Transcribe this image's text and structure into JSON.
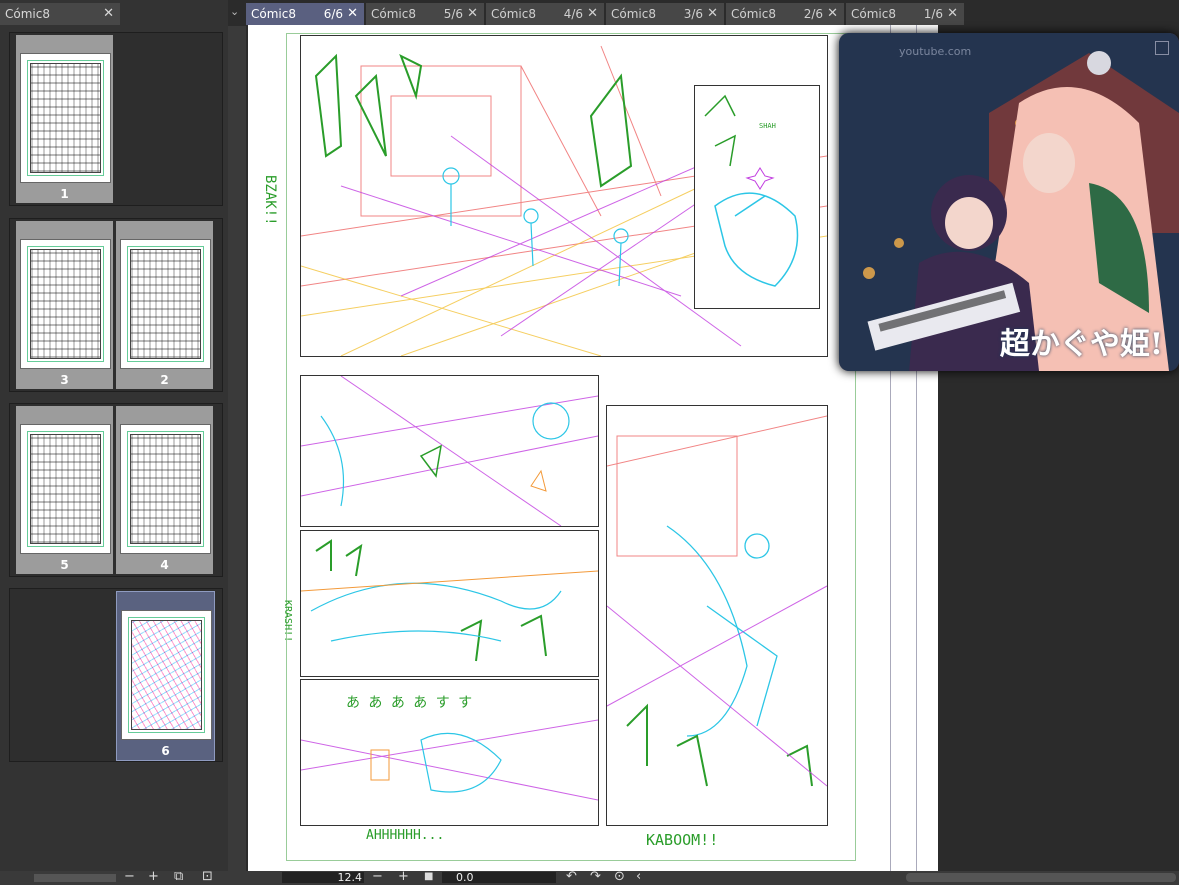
{
  "left_panel": {
    "tab": {
      "label": "Cómic8",
      "close": "✕"
    },
    "collapse": "⌄",
    "spreads": [
      {
        "pages": [
          {
            "number": "1",
            "side": "left",
            "selected": false
          }
        ]
      },
      {
        "pages": [
          {
            "number": "3",
            "side": "left",
            "selected": false
          },
          {
            "number": "2",
            "side": "right",
            "selected": false
          }
        ]
      },
      {
        "pages": [
          {
            "number": "5",
            "side": "left",
            "selected": false
          },
          {
            "number": "4",
            "side": "right",
            "selected": false
          }
        ]
      },
      {
        "pages": [
          {
            "number": "6",
            "side": "right",
            "selected": true
          }
        ]
      }
    ],
    "bottom": {
      "minus": "−",
      "plus": "+",
      "icon_a": "⧉",
      "icon_b": "⊡"
    }
  },
  "tabs": [
    {
      "name": "Cómic8",
      "count": "6/6",
      "close": "✕",
      "active": true
    },
    {
      "name": "Cómic8",
      "count": "5/6",
      "close": "✕",
      "active": false
    },
    {
      "name": "Cómic8",
      "count": "4/6",
      "close": "✕",
      "active": false
    },
    {
      "name": "Cómic8",
      "count": "3/6",
      "close": "✕",
      "active": false
    },
    {
      "name": "Cómic8",
      "count": "2/6",
      "close": "✕",
      "active": false
    },
    {
      "name": "Cómic8",
      "count": "1/6",
      "close": "✕",
      "active": false
    }
  ],
  "canvas": {
    "sfx": {
      "bzak": "BZAK!!",
      "panel_sfx": "SHAH",
      "side": "KRASH!!",
      "bottom_left": "AHHHHHH...",
      "bottom_right": "KABOOM!!",
      "aaa": "あ あ あ あ す す"
    }
  },
  "reference_image": {
    "title": "超かぐや姫!",
    "watermark": "youtube.com"
  },
  "status_bar": {
    "zoom": "12.4",
    "minus": "−",
    "plus": "+",
    "stop": "■",
    "angle": "0.0",
    "rotate_left": "↶",
    "rotate_right": "↷",
    "reset": "⊙",
    "arrow": "‹"
  },
  "colors": {
    "accent_tab": "#5a6080",
    "sketch_red": "#e66",
    "sketch_green": "#2a9d2a",
    "sketch_cyan": "#2cc6e6",
    "sketch_magenta": "#c23ee0",
    "sketch_orange": "#f39a3a"
  }
}
